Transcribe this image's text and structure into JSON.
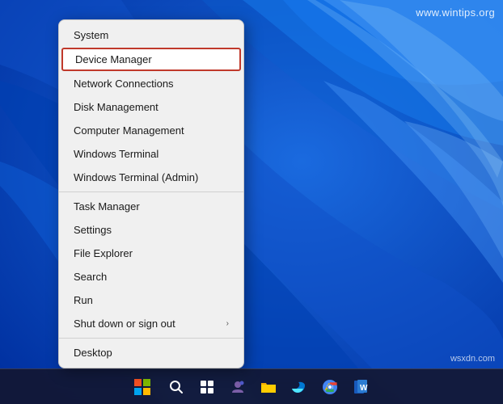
{
  "watermark": "www.wintips.org",
  "watermark2": "wsxdn.com",
  "contextMenu": {
    "items": [
      {
        "id": "system",
        "label": "System",
        "hasArrow": false,
        "highlighted": false
      },
      {
        "id": "device-manager",
        "label": "Device Manager",
        "hasArrow": false,
        "highlighted": true
      },
      {
        "id": "network-connections",
        "label": "Network Connections",
        "hasArrow": false,
        "highlighted": false
      },
      {
        "id": "disk-management",
        "label": "Disk Management",
        "hasArrow": false,
        "highlighted": false
      },
      {
        "id": "computer-management",
        "label": "Computer Management",
        "hasArrow": false,
        "highlighted": false
      },
      {
        "id": "windows-terminal",
        "label": "Windows Terminal",
        "hasArrow": false,
        "highlighted": false
      },
      {
        "id": "windows-terminal-admin",
        "label": "Windows Terminal (Admin)",
        "hasArrow": false,
        "highlighted": false
      },
      {
        "id": "task-manager",
        "label": "Task Manager",
        "hasArrow": false,
        "highlighted": false
      },
      {
        "id": "settings",
        "label": "Settings",
        "hasArrow": false,
        "highlighted": false
      },
      {
        "id": "file-explorer",
        "label": "File Explorer",
        "hasArrow": false,
        "highlighted": false
      },
      {
        "id": "search",
        "label": "Search",
        "hasArrow": false,
        "highlighted": false
      },
      {
        "id": "run",
        "label": "Run",
        "hasArrow": false,
        "highlighted": false
      },
      {
        "id": "shut-down",
        "label": "Shut down or sign out",
        "hasArrow": true,
        "highlighted": false
      },
      {
        "id": "desktop",
        "label": "Desktop",
        "hasArrow": false,
        "highlighted": false
      }
    ]
  },
  "taskbar": {
    "icons": [
      "⊞",
      "🔍",
      "📁",
      "💬",
      "📂",
      "🌐",
      "🔵",
      "📘"
    ]
  }
}
